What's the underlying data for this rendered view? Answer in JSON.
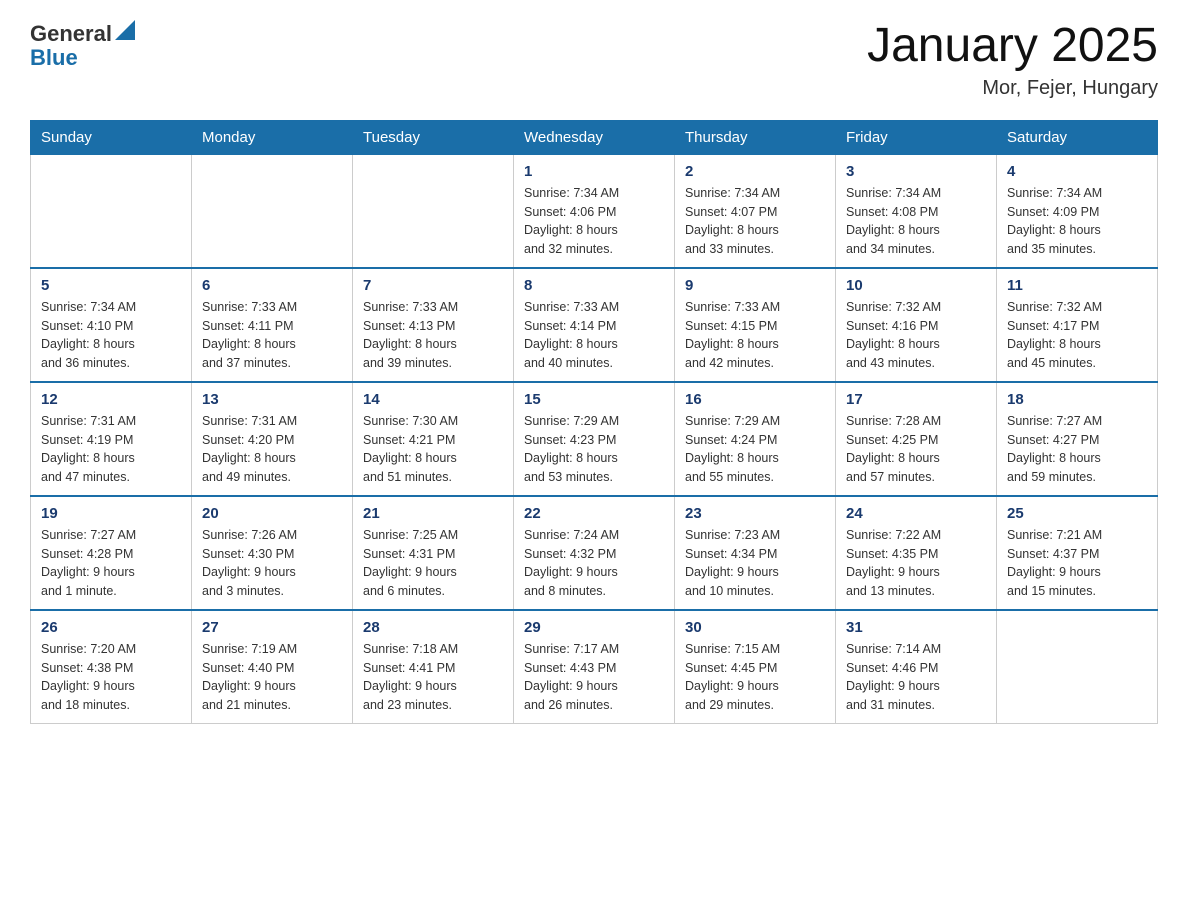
{
  "header": {
    "logo": {
      "general": "General",
      "blue": "Blue"
    },
    "title": "January 2025",
    "location": "Mor, Fejer, Hungary"
  },
  "calendar": {
    "days_of_week": [
      "Sunday",
      "Monday",
      "Tuesday",
      "Wednesday",
      "Thursday",
      "Friday",
      "Saturday"
    ],
    "weeks": [
      [
        {
          "day": "",
          "info": ""
        },
        {
          "day": "",
          "info": ""
        },
        {
          "day": "",
          "info": ""
        },
        {
          "day": "1",
          "info": "Sunrise: 7:34 AM\nSunset: 4:06 PM\nDaylight: 8 hours\nand 32 minutes."
        },
        {
          "day": "2",
          "info": "Sunrise: 7:34 AM\nSunset: 4:07 PM\nDaylight: 8 hours\nand 33 minutes."
        },
        {
          "day": "3",
          "info": "Sunrise: 7:34 AM\nSunset: 4:08 PM\nDaylight: 8 hours\nand 34 minutes."
        },
        {
          "day": "4",
          "info": "Sunrise: 7:34 AM\nSunset: 4:09 PM\nDaylight: 8 hours\nand 35 minutes."
        }
      ],
      [
        {
          "day": "5",
          "info": "Sunrise: 7:34 AM\nSunset: 4:10 PM\nDaylight: 8 hours\nand 36 minutes."
        },
        {
          "day": "6",
          "info": "Sunrise: 7:33 AM\nSunset: 4:11 PM\nDaylight: 8 hours\nand 37 minutes."
        },
        {
          "day": "7",
          "info": "Sunrise: 7:33 AM\nSunset: 4:13 PM\nDaylight: 8 hours\nand 39 minutes."
        },
        {
          "day": "8",
          "info": "Sunrise: 7:33 AM\nSunset: 4:14 PM\nDaylight: 8 hours\nand 40 minutes."
        },
        {
          "day": "9",
          "info": "Sunrise: 7:33 AM\nSunset: 4:15 PM\nDaylight: 8 hours\nand 42 minutes."
        },
        {
          "day": "10",
          "info": "Sunrise: 7:32 AM\nSunset: 4:16 PM\nDaylight: 8 hours\nand 43 minutes."
        },
        {
          "day": "11",
          "info": "Sunrise: 7:32 AM\nSunset: 4:17 PM\nDaylight: 8 hours\nand 45 minutes."
        }
      ],
      [
        {
          "day": "12",
          "info": "Sunrise: 7:31 AM\nSunset: 4:19 PM\nDaylight: 8 hours\nand 47 minutes."
        },
        {
          "day": "13",
          "info": "Sunrise: 7:31 AM\nSunset: 4:20 PM\nDaylight: 8 hours\nand 49 minutes."
        },
        {
          "day": "14",
          "info": "Sunrise: 7:30 AM\nSunset: 4:21 PM\nDaylight: 8 hours\nand 51 minutes."
        },
        {
          "day": "15",
          "info": "Sunrise: 7:29 AM\nSunset: 4:23 PM\nDaylight: 8 hours\nand 53 minutes."
        },
        {
          "day": "16",
          "info": "Sunrise: 7:29 AM\nSunset: 4:24 PM\nDaylight: 8 hours\nand 55 minutes."
        },
        {
          "day": "17",
          "info": "Sunrise: 7:28 AM\nSunset: 4:25 PM\nDaylight: 8 hours\nand 57 minutes."
        },
        {
          "day": "18",
          "info": "Sunrise: 7:27 AM\nSunset: 4:27 PM\nDaylight: 8 hours\nand 59 minutes."
        }
      ],
      [
        {
          "day": "19",
          "info": "Sunrise: 7:27 AM\nSunset: 4:28 PM\nDaylight: 9 hours\nand 1 minute."
        },
        {
          "day": "20",
          "info": "Sunrise: 7:26 AM\nSunset: 4:30 PM\nDaylight: 9 hours\nand 3 minutes."
        },
        {
          "day": "21",
          "info": "Sunrise: 7:25 AM\nSunset: 4:31 PM\nDaylight: 9 hours\nand 6 minutes."
        },
        {
          "day": "22",
          "info": "Sunrise: 7:24 AM\nSunset: 4:32 PM\nDaylight: 9 hours\nand 8 minutes."
        },
        {
          "day": "23",
          "info": "Sunrise: 7:23 AM\nSunset: 4:34 PM\nDaylight: 9 hours\nand 10 minutes."
        },
        {
          "day": "24",
          "info": "Sunrise: 7:22 AM\nSunset: 4:35 PM\nDaylight: 9 hours\nand 13 minutes."
        },
        {
          "day": "25",
          "info": "Sunrise: 7:21 AM\nSunset: 4:37 PM\nDaylight: 9 hours\nand 15 minutes."
        }
      ],
      [
        {
          "day": "26",
          "info": "Sunrise: 7:20 AM\nSunset: 4:38 PM\nDaylight: 9 hours\nand 18 minutes."
        },
        {
          "day": "27",
          "info": "Sunrise: 7:19 AM\nSunset: 4:40 PM\nDaylight: 9 hours\nand 21 minutes."
        },
        {
          "day": "28",
          "info": "Sunrise: 7:18 AM\nSunset: 4:41 PM\nDaylight: 9 hours\nand 23 minutes."
        },
        {
          "day": "29",
          "info": "Sunrise: 7:17 AM\nSunset: 4:43 PM\nDaylight: 9 hours\nand 26 minutes."
        },
        {
          "day": "30",
          "info": "Sunrise: 7:15 AM\nSunset: 4:45 PM\nDaylight: 9 hours\nand 29 minutes."
        },
        {
          "day": "31",
          "info": "Sunrise: 7:14 AM\nSunset: 4:46 PM\nDaylight: 9 hours\nand 31 minutes."
        },
        {
          "day": "",
          "info": ""
        }
      ]
    ]
  }
}
